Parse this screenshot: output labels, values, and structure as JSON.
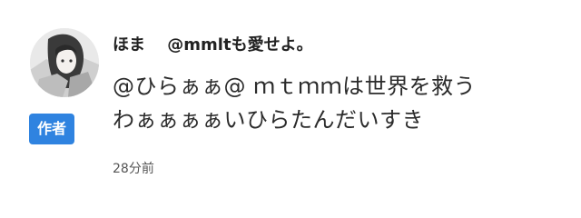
{
  "comment": {
    "author_name": "ほま",
    "author_handle": "@mmltも愛せよ。",
    "badge_label": "作者",
    "body_lines": [
      "@ひらぁぁ@ ｍｔｍｍは世界を救う",
      "わぁぁぁぁいひらたんだいすき"
    ],
    "timestamp": "28分前",
    "avatar_icon": "user-avatar-image"
  },
  "colors": {
    "badge_background": "#2f83e0",
    "badge_text": "#ffffff",
    "text": "#222222",
    "muted_text": "#555555"
  }
}
